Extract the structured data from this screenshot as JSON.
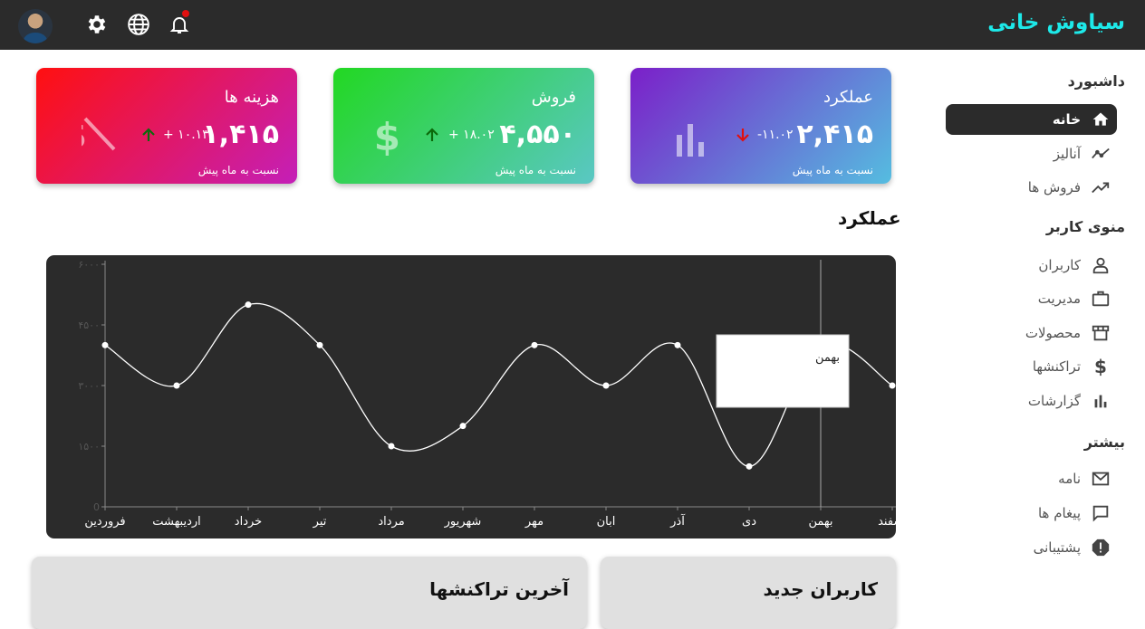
{
  "brand": "سیاوش خانی",
  "topbar": {
    "icons": [
      "avatar",
      "gear-icon",
      "globe-icon",
      "bell-icon"
    ],
    "has_notification": true
  },
  "sidebar": {
    "sections": [
      {
        "title": "داشبورد",
        "items": [
          {
            "label": "خانه",
            "icon": "home-icon",
            "active": true
          },
          {
            "label": "آنالیز",
            "icon": "timeline-icon",
            "active": false
          },
          {
            "label": "فروش ها",
            "icon": "trending-up-icon",
            "active": false
          }
        ]
      },
      {
        "title": "منوی کاربر",
        "items": [
          {
            "label": "کاربران",
            "icon": "user-icon",
            "active": false
          },
          {
            "label": "مدیریت",
            "icon": "briefcase-icon",
            "active": false
          },
          {
            "label": "محصولات",
            "icon": "store-icon",
            "active": false
          },
          {
            "label": "تراکنشها",
            "icon": "dollar-icon",
            "active": false
          },
          {
            "label": "گزارشات",
            "icon": "bar-chart-icon",
            "active": false
          }
        ]
      },
      {
        "title": "بیشتر",
        "items": [
          {
            "label": "نامه",
            "icon": "mail-icon",
            "active": false
          },
          {
            "label": "پیغام ها",
            "icon": "chat-icon",
            "active": false
          },
          {
            "label": "پشتیبانی",
            "icon": "report-icon",
            "active": false
          }
        ]
      }
    ]
  },
  "cards": [
    {
      "title": "عملکرد",
      "value": "۲,۴۱۵",
      "rate": "-۱۱.۰۲",
      "direction": "down",
      "subtitle": "نسبت به ماه پیش",
      "icon": "bar-chart-icon",
      "gradient": [
        "#7b1fc9",
        "#55bde0"
      ]
    },
    {
      "title": "فروش",
      "value": "۴,۵۵۰",
      "rate": "+ ۱۸.۰۲",
      "direction": "up",
      "subtitle": "نسبت به ماه پیش",
      "icon": "dollar-icon",
      "gradient": [
        "#22d822",
        "#5ac7c4"
      ]
    },
    {
      "title": "هزینه ها",
      "value": "۱,۴۱۵",
      "rate": "+ ۱۰.۱۳",
      "direction": "up",
      "subtitle": "نسبت به ماه پیش",
      "icon": "money-off-icon",
      "gradient": [
        "#ff1010",
        "#c41fb8"
      ]
    }
  ],
  "chart_heading": "عملکرد",
  "chart_data": {
    "type": "line",
    "title": "عملکرد",
    "categories": [
      "فروردین",
      "اردیبهشت",
      "خرداد",
      "تیر",
      "مرداد",
      "شهریور",
      "مهر",
      "ابان",
      "آذر",
      "دی",
      "بهمن",
      "اسفند"
    ],
    "values": [
      4000,
      3000,
      5000,
      4000,
      1500,
      2000,
      4000,
      3000,
      4000,
      1000,
      4000,
      3000
    ],
    "ylim": [
      0,
      6000
    ],
    "yticks": [
      "0",
      "۱۵۰۰",
      "۳۰۰۰",
      "۴۵۰۰",
      "۶۰۰۰"
    ],
    "ytick_values": [
      0,
      1500,
      3000,
      4500,
      6000
    ],
    "grid": false,
    "line_color": "#ffffff",
    "background": "#2b2b2b",
    "tooltip": {
      "category": "بهمن"
    }
  },
  "panels": [
    {
      "title": "آخرین تراکنشها"
    },
    {
      "title": "کاربران جدید"
    }
  ]
}
